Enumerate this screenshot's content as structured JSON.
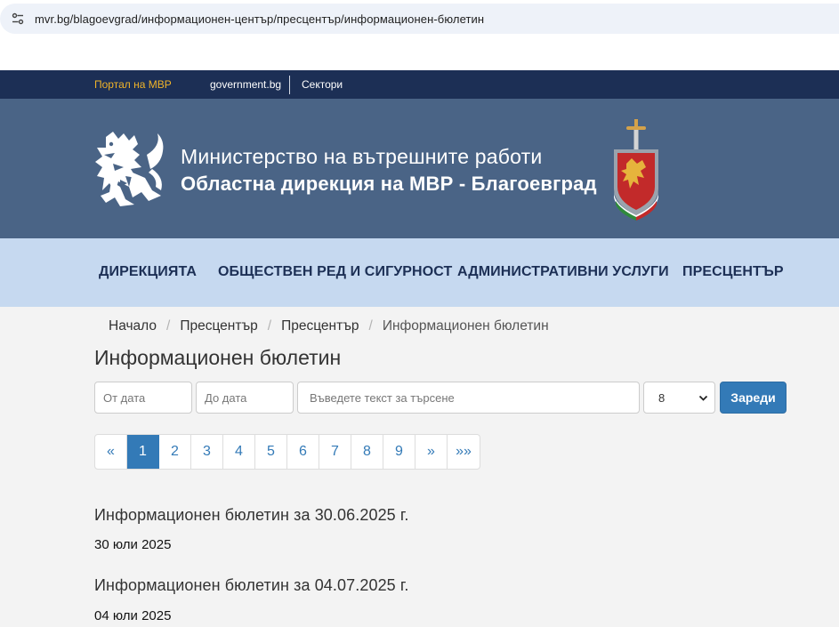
{
  "browser": {
    "url": "mvr.bg/blagoevgrad/информационен-център/пресцентър/информационен-бюлетин"
  },
  "topbar": {
    "portal": "Портал на МВР",
    "government": "government.bg",
    "sectors": "Сектори"
  },
  "header": {
    "line1": "Министерство на вътрешните работи",
    "line2": "Областна дирекция на МВР - Благоевград"
  },
  "nav": {
    "items": [
      "ДИРЕКЦИЯТА",
      "ОБЩЕСТВЕН РЕД И СИГУРНОСТ",
      "АДМИНИСТРАТИВНИ УСЛУГИ",
      "ПРЕСЦЕНТЪР"
    ]
  },
  "breadcrumb": [
    "Начало",
    "Пресцентър",
    "Пресцентър",
    "Информационен бюлетин"
  ],
  "page_title": "Информационен бюлетин",
  "filters": {
    "from_placeholder": "От дата",
    "to_placeholder": "До дата",
    "search_placeholder": "Въведете текст за търсене",
    "page_size": "8",
    "load_button": "Зареди"
  },
  "pagination": {
    "first": "«",
    "pages": [
      "1",
      "2",
      "3",
      "4",
      "5",
      "6",
      "7",
      "8",
      "9"
    ],
    "next": "»",
    "last": "»»",
    "active": "1"
  },
  "items": [
    {
      "title": "Информационен бюлетин за 30.06.2025 г.",
      "date": "30 юли 2025"
    },
    {
      "title": "Информационен бюлетин за 04.07.2025 г.",
      "date": "04 юли 2025"
    }
  ],
  "colors": {
    "topbar": "#1c2f55",
    "header": "#4a6486",
    "nav": "#c6d9f0",
    "accent": "#337ab7",
    "portal_link": "#f0b429"
  }
}
